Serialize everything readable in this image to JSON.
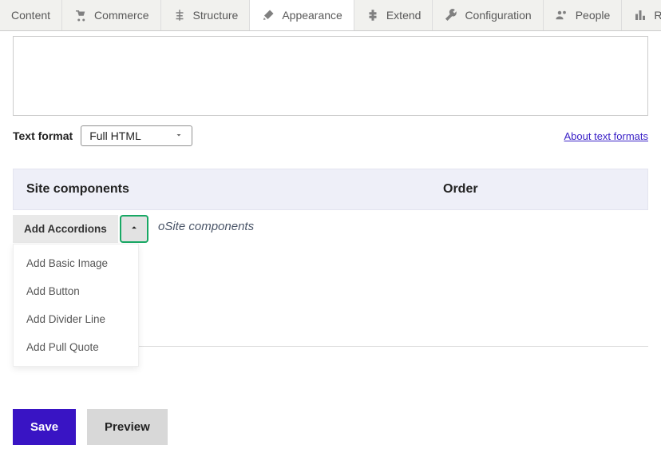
{
  "toolbar": {
    "items": [
      {
        "label": "Content",
        "icon": "content"
      },
      {
        "label": "Commerce",
        "icon": "commerce"
      },
      {
        "label": "Structure",
        "icon": "structure"
      },
      {
        "label": "Appearance",
        "icon": "appearance"
      },
      {
        "label": "Extend",
        "icon": "extend"
      },
      {
        "label": "Configuration",
        "icon": "configuration"
      },
      {
        "label": "People",
        "icon": "people"
      },
      {
        "label": "Reports",
        "icon": "reports"
      }
    ]
  },
  "text_format": {
    "label": "Text format",
    "selected": "Full HTML",
    "about_link": "About text formats"
  },
  "components": {
    "header_col1": "Site components",
    "header_col2": "Order",
    "placeholder_suffix": "Site components",
    "placeholder_visible_prefix": "o",
    "split_button": {
      "primary": "Add Accordions",
      "options": [
        "Add Basic Image",
        "Add Button",
        "Add Divider Line",
        "Add Pull Quote"
      ]
    }
  },
  "actions": {
    "save": "Save",
    "preview": "Preview"
  }
}
